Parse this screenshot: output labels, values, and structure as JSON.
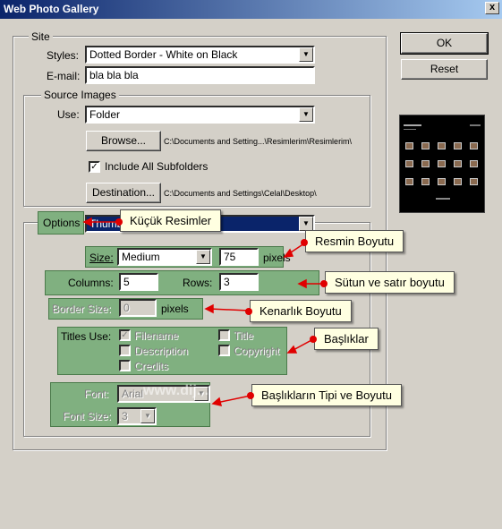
{
  "window": {
    "title": "Web Photo Gallery",
    "close_glyph": "x"
  },
  "site": {
    "legend": "Site",
    "styles_label": "Styles:",
    "styles_value": "Dotted Border - White on Black",
    "email_label": "E-mail:",
    "email_value": "bla bla bla"
  },
  "source": {
    "legend": "Source Images",
    "use_label": "Use:",
    "use_value": "Folder",
    "browse_label": "Browse...",
    "browse_path": "C:\\Documents and Setting...\\Resimlerim\\Resimlerim\\",
    "include_label": "Include All Subfolders",
    "include_checked": "✓",
    "destination_label": "Destination...",
    "destination_path": "C:\\Documents and Settings\\Celal\\Desktop\\"
  },
  "options": {
    "legend": "Options",
    "value": "Thumb",
    "size_label": "Size:",
    "size_value": "Medium",
    "size_px": "75",
    "pixels_label": "pixels",
    "columns_label": "Columns:",
    "columns_value": "5",
    "rows_label": "Rows:",
    "rows_value": "3",
    "border_label": "Border Size:",
    "border_value": "0",
    "border_pixels_label": "pixels",
    "titles_use_label": "Titles Use:",
    "filename_label": "Filename",
    "filename_checked": "✓",
    "description_label": "Description",
    "credits_label": "Credits",
    "title_label": "Title",
    "copyright_label": "Copyright",
    "font_label": "Font:",
    "font_value": "Arial",
    "font_size_label": "Font Size:",
    "font_size_value": "3"
  },
  "buttons": {
    "ok": "OK",
    "reset": "Reset"
  },
  "callouts": {
    "kucuk_resimler": "Küçük Resimler",
    "resmin_boyutu": "Resmin Boyutu",
    "sutun_satir": "Sütun ve satır boyutu",
    "kenarlik": "Kenarlık Boyutu",
    "basliklar": "Başlıklar",
    "baslik_tipi": "Başlıkların Tipi ve Boyutu"
  },
  "watermark": "www.dij...",
  "colors": {
    "highlight": "#80b080",
    "callout_bg": "#ffffe1",
    "arrow": "#e00000",
    "titlebar": "#0a246a"
  }
}
